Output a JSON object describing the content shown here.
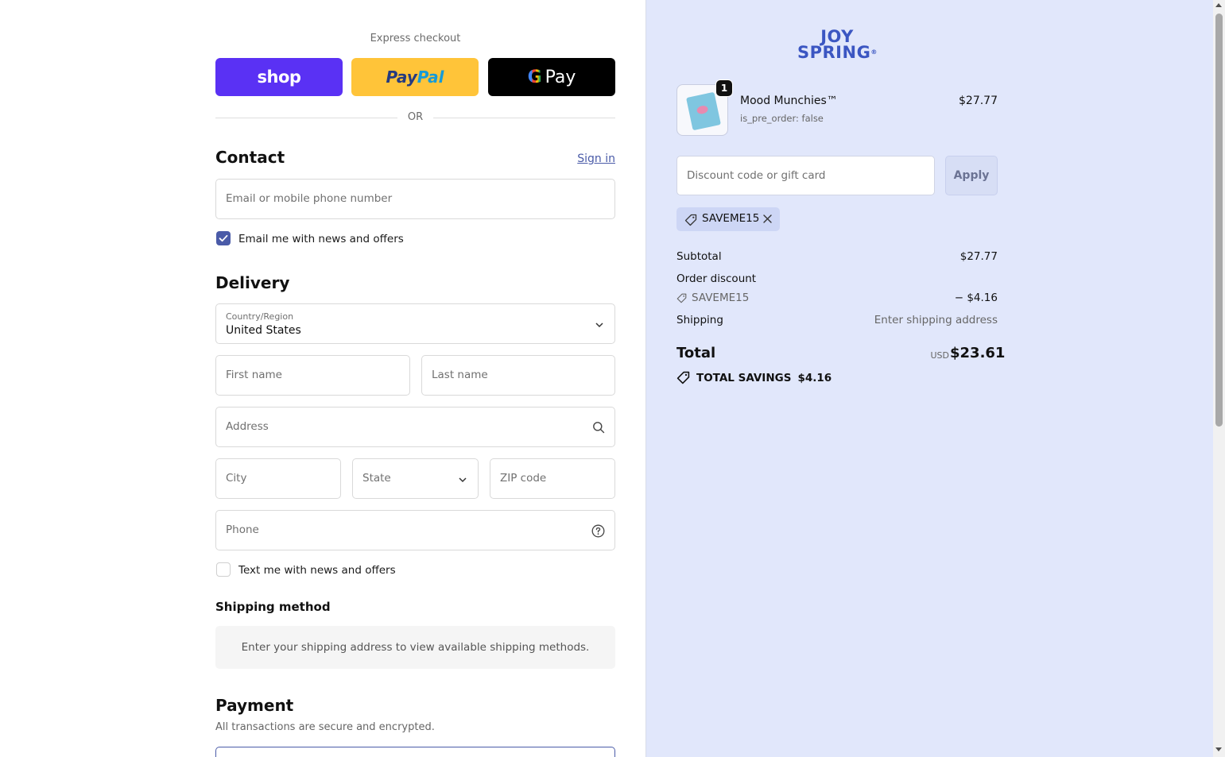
{
  "express": {
    "label": "Express checkout",
    "shop": "shop",
    "paypal_a": "Pay",
    "paypal_b": "Pal",
    "gpay_g": "G",
    "gpay_text": "Pay",
    "or": "OR"
  },
  "contact": {
    "heading": "Contact",
    "signin": "Sign in",
    "email_placeholder": "Email or mobile phone number",
    "newsletter_label": "Email me with news and offers",
    "newsletter_checked": true
  },
  "delivery": {
    "heading": "Delivery",
    "country_label": "Country/Region",
    "country_value": "United States",
    "first_name": "First name",
    "last_name": "Last name",
    "address": "Address",
    "city": "City",
    "state": "State",
    "zip": "ZIP code",
    "phone": "Phone",
    "sms_label": "Text me with news and offers",
    "sms_checked": false
  },
  "shipping": {
    "heading": "Shipping method",
    "message": "Enter your shipping address to view available shipping methods."
  },
  "payment": {
    "heading": "Payment",
    "subtitle": "All transactions are secure and encrypted."
  },
  "summary": {
    "logo_line1": "JOY",
    "logo_line2": "SPRING",
    "logo_mark": "®",
    "item": {
      "name": "Mood Munchies™",
      "meta": "is_pre_order: false",
      "price": "$27.77",
      "quantity": "1"
    },
    "discount_placeholder": "Discount code or gift card",
    "apply": "Apply",
    "applied_code": "SAVEME15",
    "subtotal_label": "Subtotal",
    "subtotal_value": "$27.77",
    "order_discount_label": "Order discount",
    "order_discount_code": "SAVEME15",
    "order_discount_value": "− $4.16",
    "shipping_label": "Shipping",
    "shipping_value": "Enter shipping address",
    "total_label": "Total",
    "currency": "USD",
    "total_value": "$23.61",
    "savings_label": "TOTAL SAVINGS",
    "savings_value": "$4.16"
  },
  "colors": {
    "accent": "#4a5ba8",
    "shop_purple": "#5a31f4",
    "paypal_yellow": "#ffc439",
    "summary_bg": "#e1e7fb"
  }
}
